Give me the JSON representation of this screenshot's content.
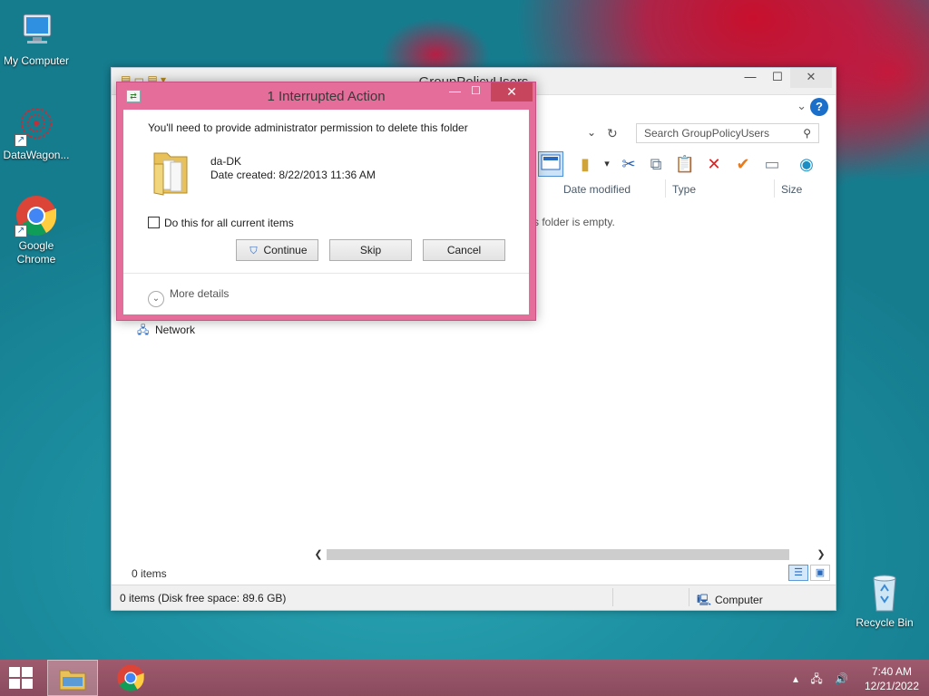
{
  "desktop": {
    "icons": [
      {
        "label": "My Computer"
      },
      {
        "label": "DataWagon..."
      },
      {
        "label": "Google Chrome"
      },
      {
        "label": "Recycle Bin"
      }
    ]
  },
  "explorer": {
    "title": "GroupPolicyUsers",
    "search_placeholder": "Search GroupPolicyUsers",
    "columns": [
      "Date modified",
      "Type",
      "Size"
    ],
    "empty_message": "s folder is empty.",
    "nav_network": "Network",
    "items_count": "0 items",
    "status_left": "0 items (Disk free space: 89.6 GB)",
    "status_right": "Computer"
  },
  "dialog": {
    "title": "1 Interrupted Action",
    "message": "You'll need to provide administrator permission to delete this folder",
    "item_name": "da-DK",
    "item_date": "Date created: 8/22/2013 11:36 AM",
    "checkbox_label": "Do this for all current items",
    "continue_label": "Continue",
    "skip_label": "Skip",
    "cancel_label": "Cancel",
    "more_details": "More details"
  },
  "taskbar": {
    "time": "7:40 AM",
    "date": "12/21/2022"
  },
  "colors": {
    "dialog_frame": "#e46d99",
    "taskbar": "#9f5a6e",
    "close_button": "#c7465d"
  }
}
